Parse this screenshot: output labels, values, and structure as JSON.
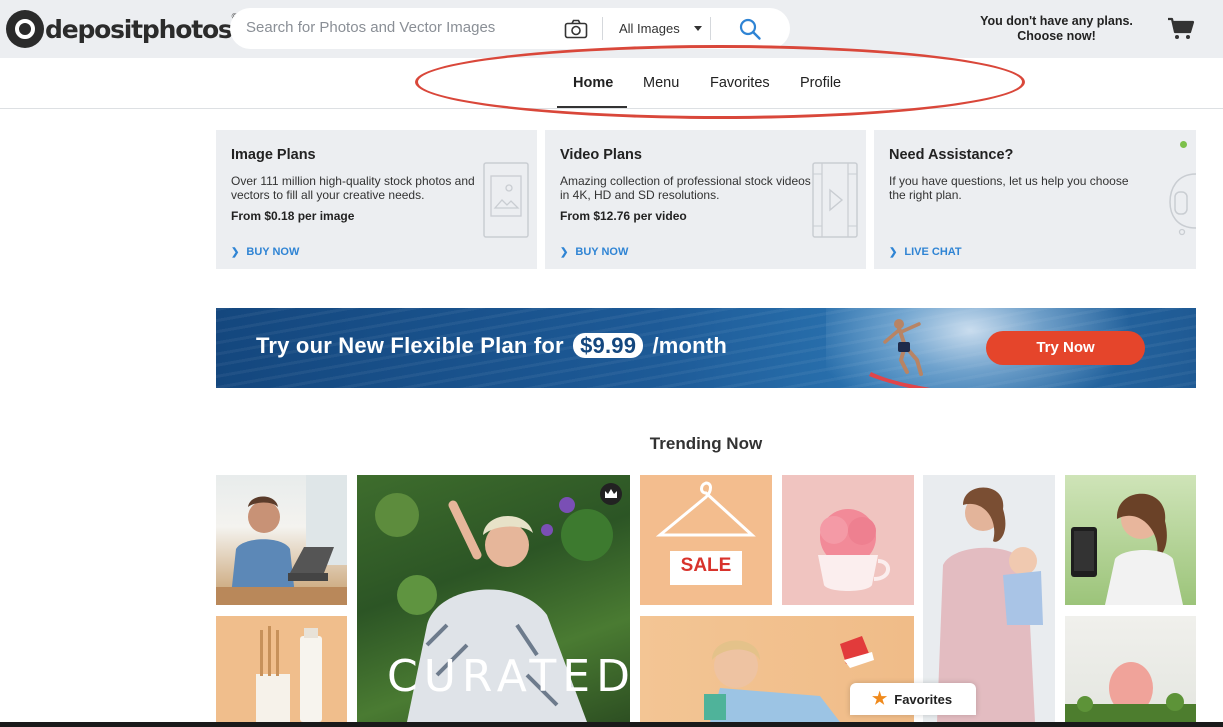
{
  "header": {
    "logo_text": "depositphotos",
    "logo_mark": "®",
    "search_placeholder": "Search for Photos and Vector Images",
    "category": "All Images",
    "plans_note_line1": "You don't have any plans.",
    "plans_note_line2": "Choose now!"
  },
  "nav": {
    "items": [
      {
        "label": "Home",
        "active": true
      },
      {
        "label": "Menu"
      },
      {
        "label": "Favorites"
      },
      {
        "label": "Profile"
      }
    ]
  },
  "cards": [
    {
      "title": "Image Plans",
      "desc": "Over 111 million high-quality stock photos and vectors to fill all your creative needs.",
      "price": "From $0.18 per image",
      "link": "BUY NOW",
      "icon": "image-icon"
    },
    {
      "title": "Video Plans",
      "desc": "Amazing collection of professional stock videos in 4K, HD and SD resolutions.",
      "price": "From $12.76 per video",
      "link": "BUY NOW",
      "icon": "video-icon"
    },
    {
      "title": "Need Assistance?",
      "desc": "If you have questions, let us help you choose the right plan.",
      "link": "LIVE CHAT",
      "icon": "headset-icon"
    }
  ],
  "banner": {
    "text_before": "Try our New Flexible Plan for",
    "price": "$9.99",
    "text_after": "/month",
    "cta": "Try Now"
  },
  "trending": {
    "title": "Trending Now",
    "curated_label": "CURATED",
    "sale_label": "SALE"
  },
  "favorites_pill": "Favorites",
  "colors": {
    "accent_blue": "#2f84d4",
    "cta_red": "#e5452b",
    "annotation": "#d9473a",
    "online_green": "#7cc04a"
  }
}
